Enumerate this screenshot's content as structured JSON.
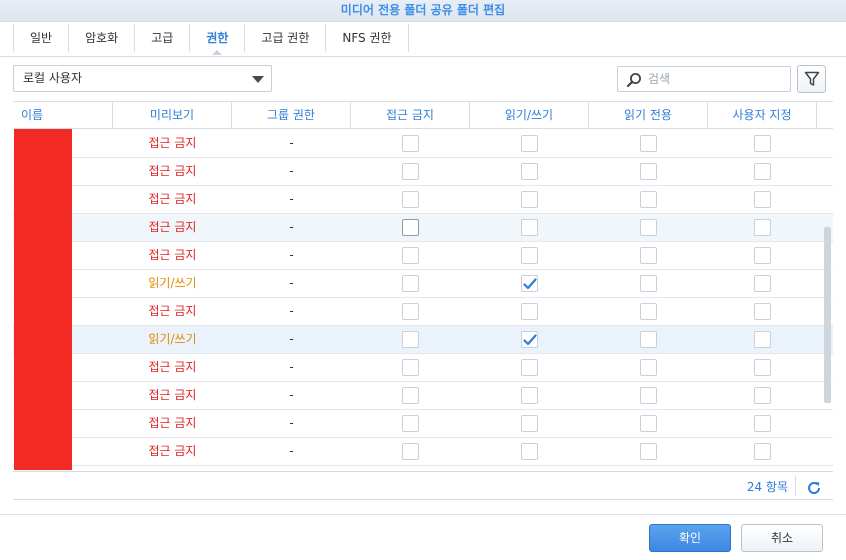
{
  "window": {
    "title": "미디어 전용 폴더 공유 폴더 편집"
  },
  "tabs": [
    {
      "label": "일반",
      "active": false
    },
    {
      "label": "암호화",
      "active": false
    },
    {
      "label": "고급",
      "active": false
    },
    {
      "label": "권한",
      "active": true
    },
    {
      "label": "고급 권한",
      "active": false
    },
    {
      "label": "NFS 권한",
      "active": false
    }
  ],
  "user_type_dropdown": {
    "selected": "로컬 사용자"
  },
  "search": {
    "placeholder": "검색",
    "value": ""
  },
  "filter": {
    "icon": "filter-icon"
  },
  "table": {
    "columns": [
      "이름",
      "미리보기",
      "그룹 권한",
      "접근 금지",
      "읽기/쓰기",
      "읽기 전용",
      "사용자 지정"
    ],
    "rows": [
      {
        "preview": "접근 금지",
        "group": "-",
        "deny": false,
        "rw": false,
        "ro": false,
        "custom": false
      },
      {
        "preview": "접근 금지",
        "group": "-",
        "deny": false,
        "rw": false,
        "ro": false,
        "custom": false
      },
      {
        "preview": "접근 금지",
        "group": "-",
        "deny": false,
        "rw": false,
        "ro": false,
        "custom": false
      },
      {
        "preview": "접근 금지",
        "group": "-",
        "deny": false,
        "rw": false,
        "ro": false,
        "custom": false
      },
      {
        "preview": "접근 금지",
        "group": "-",
        "deny": false,
        "rw": false,
        "ro": false,
        "custom": false
      },
      {
        "preview": "읽기/쓰기",
        "group": "-",
        "deny": false,
        "rw": true,
        "ro": false,
        "custom": false
      },
      {
        "preview": "접근 금지",
        "group": "-",
        "deny": false,
        "rw": false,
        "ro": false,
        "custom": false
      },
      {
        "preview": "읽기/쓰기",
        "group": "-",
        "deny": false,
        "rw": true,
        "ro": false,
        "custom": false
      },
      {
        "preview": "접근 금지",
        "group": "-",
        "deny": false,
        "rw": false,
        "ro": false,
        "custom": false
      },
      {
        "preview": "접근 금지",
        "group": "-",
        "deny": false,
        "rw": false,
        "ro": false,
        "custom": false
      },
      {
        "preview": "접근 금지",
        "group": "-",
        "deny": false,
        "rw": false,
        "ro": false,
        "custom": false
      },
      {
        "preview": "접근 금지",
        "group": "-",
        "deny": false,
        "rw": false,
        "ro": false,
        "custom": false
      }
    ]
  },
  "footer": {
    "count": "24 항목",
    "refresh_icon": "refresh-icon"
  },
  "buttons": {
    "ok": "확인",
    "cancel": "취소"
  },
  "colors": {
    "accent": "#2f7fd8",
    "deny_text": "#e02424",
    "rw_text": "#e58a00",
    "redacted": "#f32a23"
  }
}
